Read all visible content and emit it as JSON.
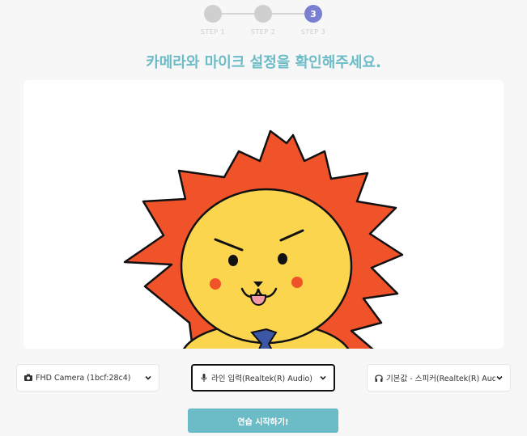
{
  "stepper": {
    "steps": [
      {
        "label": "STEP 1",
        "number": ""
      },
      {
        "label": "STEP 2",
        "number": ""
      },
      {
        "label": "STEP 3",
        "number": "3"
      }
    ],
    "active_step": 3
  },
  "title": "카메라와 마이크 설정을 확인해주세요.",
  "devices": {
    "camera": {
      "icon": "camera-icon",
      "value": "FHD Camera (1bcf:28c4)"
    },
    "microphone": {
      "icon": "microphone-icon",
      "value": "라인 입력(Realtek(R) Audio)"
    },
    "speaker": {
      "icon": "headphones-icon",
      "value": "기본값 - 스피커(Realtek(R) Audio)"
    }
  },
  "start_button": "연습 시작하기!",
  "colors": {
    "accent": "#6cbcc7",
    "active_step": "#7a7fd1",
    "inactive_step": "#cfcfcf",
    "mane": "#f0522a",
    "face": "#fcd54f",
    "cheek": "#f0522a",
    "tie": "#3c57a6"
  }
}
